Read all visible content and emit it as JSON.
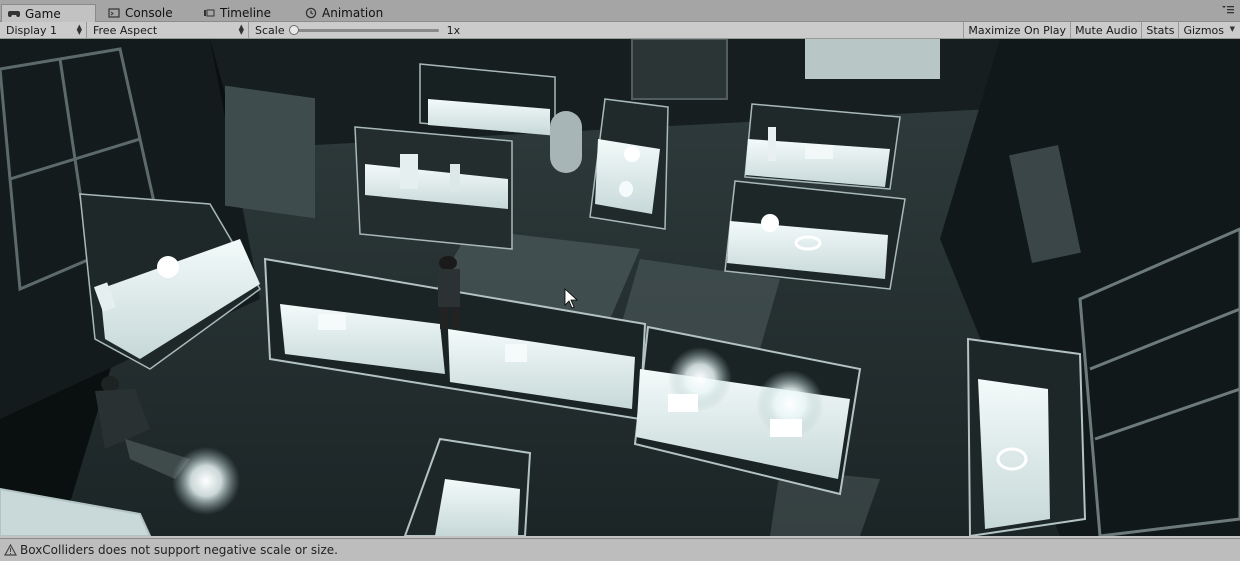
{
  "tabs": [
    {
      "label": "Game",
      "icon": "game-controller-icon",
      "active": true
    },
    {
      "label": "Console",
      "icon": "console-icon",
      "active": false
    },
    {
      "label": "Timeline",
      "icon": "timeline-icon",
      "active": false
    },
    {
      "label": "Animation",
      "icon": "animation-clock-icon",
      "active": false
    }
  ],
  "toolbar": {
    "display": "Display 1",
    "aspect": "Free Aspect",
    "scale_label": "Scale",
    "scale_value": "1x",
    "scale_fraction": 0.0,
    "maximize_on_play": "Maximize On Play",
    "mute_audio": "Mute Audio",
    "stats": "Stats",
    "gizmos": "Gizmos"
  },
  "status": {
    "message": "BoxColliders does not support negative scale or size.",
    "icon": "warning-triangle-icon"
  },
  "colors": {
    "editor_bg": "#c2c2c2",
    "scene_floor": "#3a4547",
    "case_glow": "#e8f2f2"
  }
}
